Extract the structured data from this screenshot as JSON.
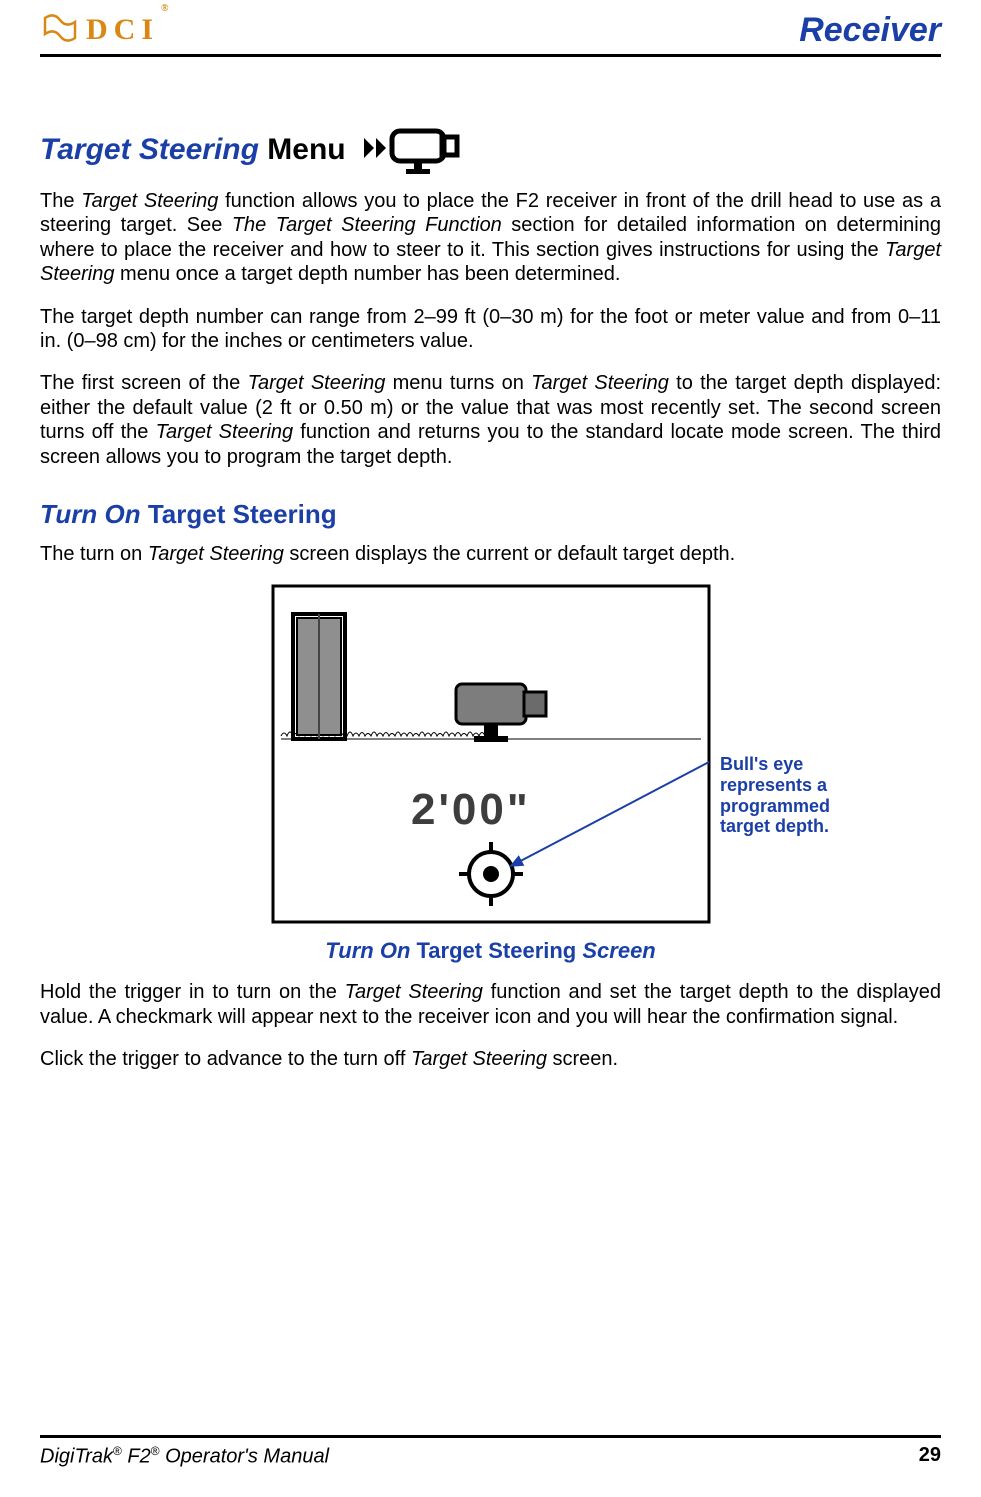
{
  "header": {
    "logo_text": "DCI",
    "section_name": "Receiver"
  },
  "h1": {
    "blue": "Target Steering",
    "black": " Menu"
  },
  "para1_a": "The ",
  "para1_b": "Target Steering",
  "para1_c": " function allows you to place the F2 receiver in front of the drill head to use as a steering target. See ",
  "para1_d": "The Target Steering Function",
  "para1_e": " section for detailed information on determining where to place the receiver and how to steer to it. This section gives instructions for using the ",
  "para1_f": "Target Steering",
  "para1_g": " menu once a target depth number has been determined.",
  "para2": "The target depth number can range from 2–99 ft (0–30 m) for the foot or meter value and from 0–11 in. (0–98 cm) for the inches or centimeters value.",
  "para3_a": "The first screen of the ",
  "para3_b": "Target Steering",
  "para3_c": " menu turns on ",
  "para3_d": "Target Steering",
  "para3_e": " to the target depth displayed: either the default value (2 ft or 0.50 m) or the value that was most recently set. The second screen turns off the ",
  "para3_f": "Target Steering",
  "para3_g": " function and returns you to the standard locate mode screen. The third screen allows you to program the target depth.",
  "h2": {
    "blue": "Turn On",
    "black": " Target Steering"
  },
  "para4_a": "The turn on ",
  "para4_b": "Target Steering",
  "para4_c": " screen displays the current or default target depth.",
  "figure": {
    "depth_label": "2'00\"",
    "annotation": "Bull's eye represents a programmed target depth."
  },
  "figcap": {
    "a": "Turn On",
    "b": " Target Steering ",
    "c": "Screen"
  },
  "para5_a": "Hold the trigger in to turn on the ",
  "para5_b": "Target Steering",
  "para5_c": " function and set the target depth to the displayed value. A checkmark will appear next to the receiver icon and you will hear the confirmation signal.",
  "para6_a": "Click the trigger to advance to the turn off ",
  "para6_b": "Target Steering",
  "para6_c": " screen.",
  "footer": {
    "product_a": "DigiTrak",
    "product_b": " F2",
    "product_c": " Operator's Manual",
    "page": "29"
  }
}
